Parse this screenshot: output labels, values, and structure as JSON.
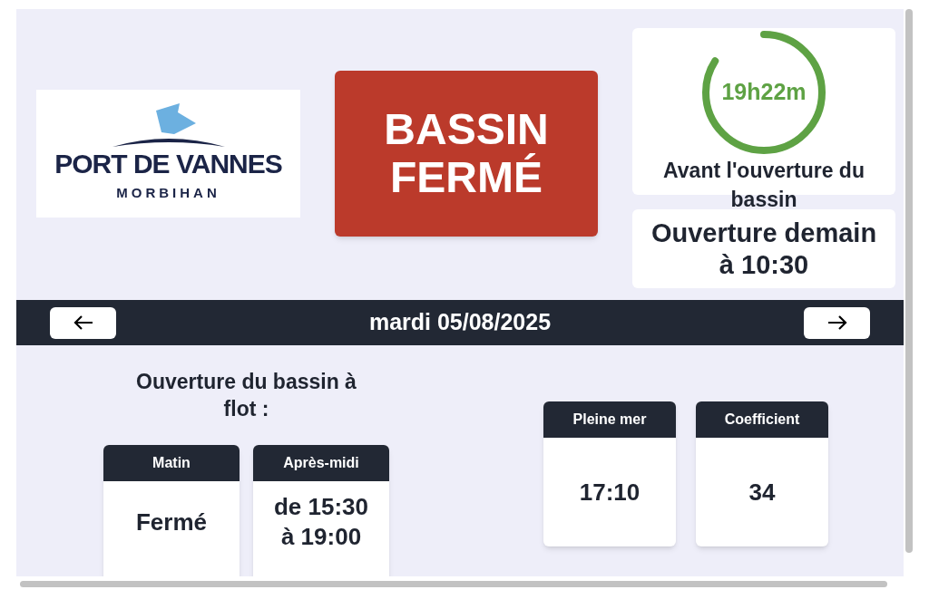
{
  "logo": {
    "name": "PORT DE VANNES",
    "region": "MORBIHAN"
  },
  "status": {
    "text": "BASSIN FERMÉ"
  },
  "countdown": {
    "time": "19h22m",
    "level": 0.84,
    "label": "Avant l'ouverture du bassin"
  },
  "next_opening": "Ouverture demain à 10:30",
  "date_bar": {
    "date": "mardi 05/08/2025"
  },
  "schedule": {
    "title": "Ouverture du bassin à flot :",
    "slots": [
      {
        "label": "Matin",
        "value": "Fermé"
      },
      {
        "label": "Après-midi",
        "value": "de 15:30 à 19:00"
      }
    ]
  },
  "tide": [
    {
      "label": "Pleine mer",
      "value": "17:10"
    },
    {
      "label": "Coefficient",
      "value": "34"
    }
  ]
}
